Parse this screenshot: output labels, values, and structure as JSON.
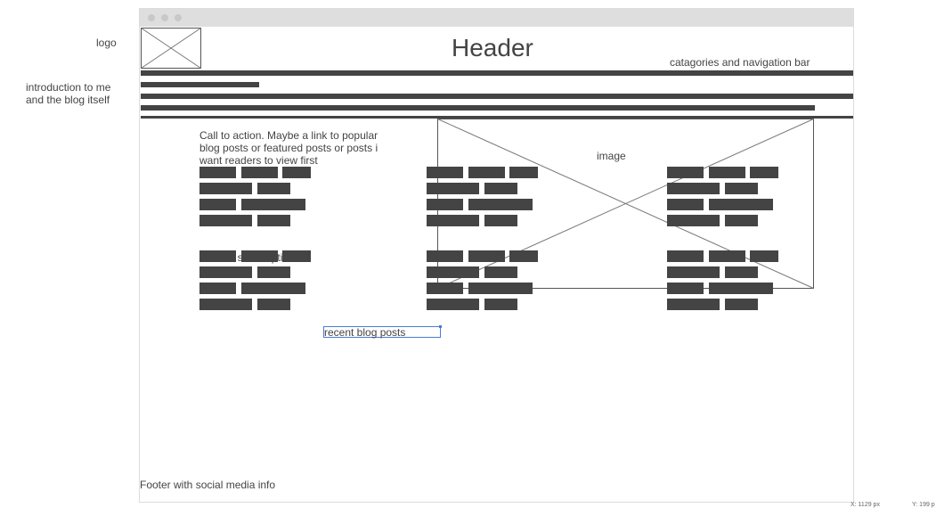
{
  "annotations": {
    "logo": "logo",
    "intro_line1": "introduction to me",
    "intro_line2": "and the blog itself"
  },
  "header": {
    "title": "Header",
    "nav_label": "catagories and navigation bar"
  },
  "hero": {
    "cta_line1": "Call to action. Maybe a link to popular",
    "cta_line2": "blog posts or featured posts or posts i",
    "cta_line3": "want readers to view first",
    "subscribe": "Link for subscription",
    "image_label": "image"
  },
  "posts": {
    "label": "recent blog posts"
  },
  "footer": {
    "text": "Footer with social media info"
  },
  "status": {
    "x_readout": "X: 1129 px",
    "y_readout": "Y: 199 p"
  },
  "colors": {
    "ink": "#444444",
    "chrome": "#dedede",
    "selection": "#4a7bd8"
  }
}
